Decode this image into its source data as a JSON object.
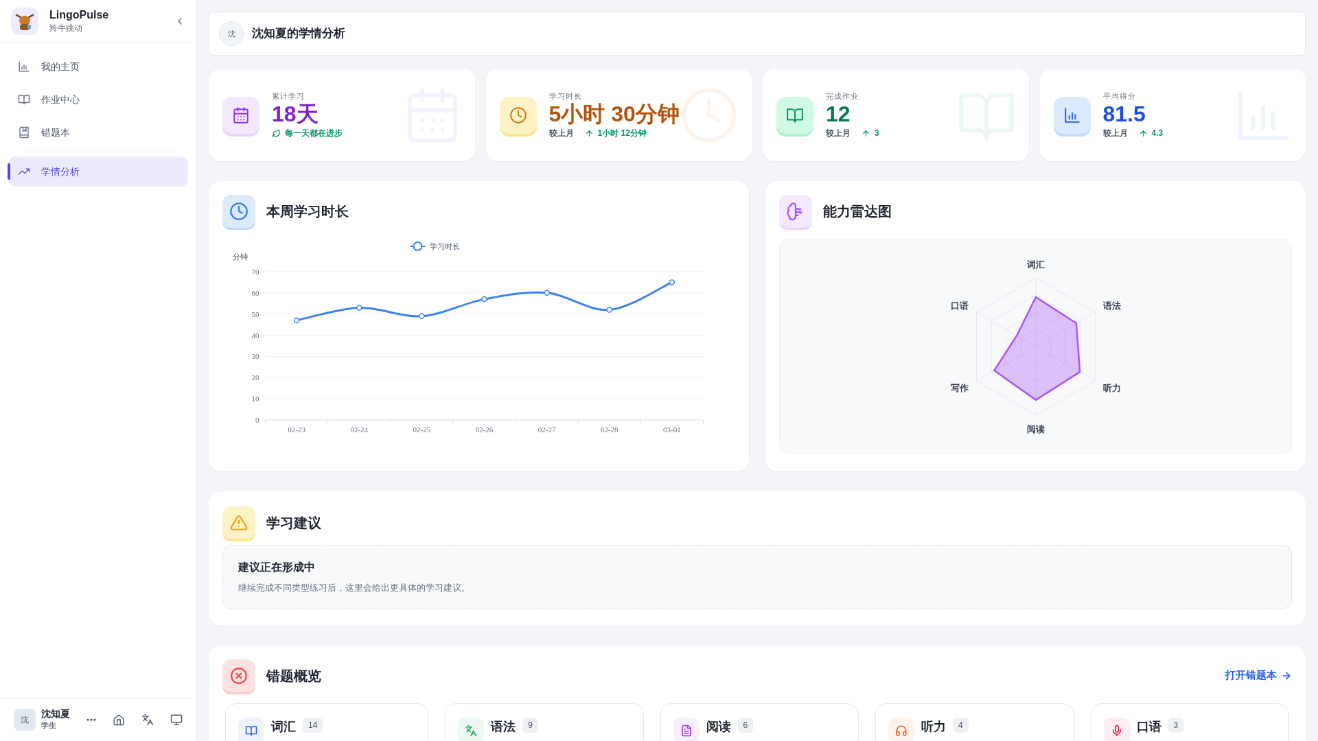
{
  "sidebar": {
    "brand": {
      "name": "LingoPulse",
      "tagline": "羚牛跳动"
    },
    "nav": [
      {
        "label": "我的主页",
        "selected": false
      },
      {
        "label": "作业中心",
        "selected": false
      },
      {
        "label": "错题本",
        "selected": false
      },
      {
        "label": "学情分析",
        "selected": true
      }
    ],
    "user": {
      "avatar": "沈",
      "name": "沈知夏",
      "role": "学生"
    }
  },
  "header": {
    "avatar": "沈",
    "title": "沈知夏的学情分析"
  },
  "stats": [
    {
      "label": "累计学习",
      "value": "18天",
      "note": "每一天都在进步"
    },
    {
      "label": "学习时长",
      "value": "5小时 30分钟",
      "compare": "较上月",
      "delta": "1小时 12分钟"
    },
    {
      "label": "完成作业",
      "value": "12",
      "compare": "较上月",
      "delta": "3"
    },
    {
      "label": "平均得分",
      "value": "81.5",
      "compare": "较上月",
      "delta": "4.3"
    }
  ],
  "weekly": {
    "title": "本周学习时长",
    "chart_data": {
      "type": "line",
      "ylabel": "分钟",
      "categories": [
        "02-23",
        "02-24",
        "02-25",
        "02-26",
        "02-27",
        "02-28",
        "03-01"
      ],
      "series": [
        {
          "name": "学习时长",
          "color": "#3b82f6",
          "marker": "circle",
          "values": [
            47,
            53,
            49,
            57,
            60,
            52,
            65
          ]
        }
      ],
      "grid": true,
      "ylim": [
        0,
        70
      ],
      "yticks": [
        0,
        10,
        20,
        30,
        40,
        50,
        60,
        70
      ]
    }
  },
  "radar": {
    "title": "能力雷达图",
    "axes": [
      "词汇",
      "语法",
      "听力",
      "阅读",
      "写作",
      "口语"
    ]
  },
  "advice": {
    "title": "学习建议",
    "heading": "建议正在形成中",
    "text": "继续完成不同类型练习后，这里会给出更具体的学习建议。"
  },
  "mistakes": {
    "title": "错题概览",
    "link": "打开错题本",
    "categories": [
      {
        "label": "词汇",
        "count": "14",
        "color": "#2563eb"
      },
      {
        "label": "语法",
        "count": "9",
        "color": "#16a34a"
      },
      {
        "label": "阅读",
        "count": "6",
        "color": "#9333ea"
      },
      {
        "label": "听力",
        "count": "4",
        "color": "#ea580c"
      },
      {
        "label": "口语",
        "count": "3",
        "color": "#e11d48"
      }
    ]
  }
}
